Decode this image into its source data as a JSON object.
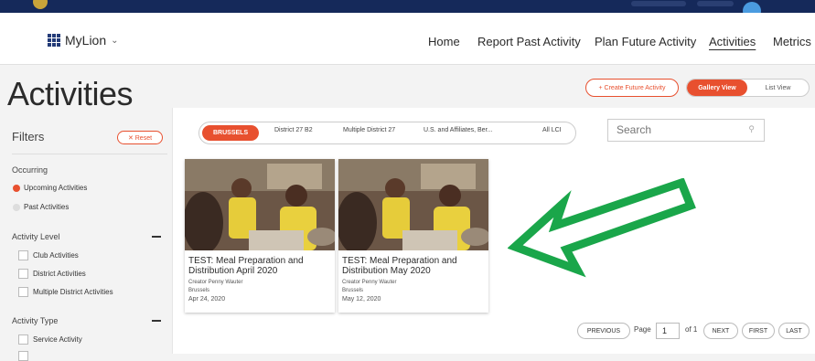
{
  "nav": {
    "brand": "MyLion",
    "links": [
      "Home",
      "Report Past Activity",
      "Plan Future Activity",
      "Activities",
      "Metrics"
    ],
    "active": "Activities"
  },
  "page": {
    "title": "Activities",
    "create_label": "+ Create Future Activity",
    "gallery_label": "Gallery View",
    "list_label": "List View"
  },
  "filters": {
    "title": "Filters",
    "reset_label": "✕ Reset",
    "occurring": {
      "title": "Occurring",
      "options": [
        "Upcoming Activities",
        "Past Activities"
      ]
    },
    "level": {
      "title": "Activity Level",
      "options": [
        "Club Activities",
        "District Activities",
        "Multiple District Activities"
      ]
    },
    "type": {
      "title": "Activity Type",
      "options": [
        "Service Activity"
      ]
    }
  },
  "tabs": [
    "BRUSSELS",
    "District 27 B2",
    "Multiple District 27",
    "U.S. and Affiliates, Ber...",
    "All LCI"
  ],
  "search": {
    "placeholder": "Search"
  },
  "cards": [
    {
      "title": "TEST: Meal Preparation and Distribution April 2020",
      "creator": "Creator Penny Wauter",
      "location": "Brussels",
      "date": "Apr 24, 2020"
    },
    {
      "title": "TEST: Meal Preparation and Distribution May 2020",
      "creator": "Creator Penny Wauter",
      "location": "Brussels",
      "date": "May 12, 2020"
    }
  ],
  "pagination": {
    "previous": "PREVIOUS",
    "page_label": "Page",
    "page_value": "1",
    "of_label": "of 1",
    "next": "NEXT",
    "first": "FIRST",
    "last": "LAST"
  },
  "colors": {
    "accent": "#e8502f",
    "navy": "#15295a",
    "arrow": "#1aa64a"
  }
}
